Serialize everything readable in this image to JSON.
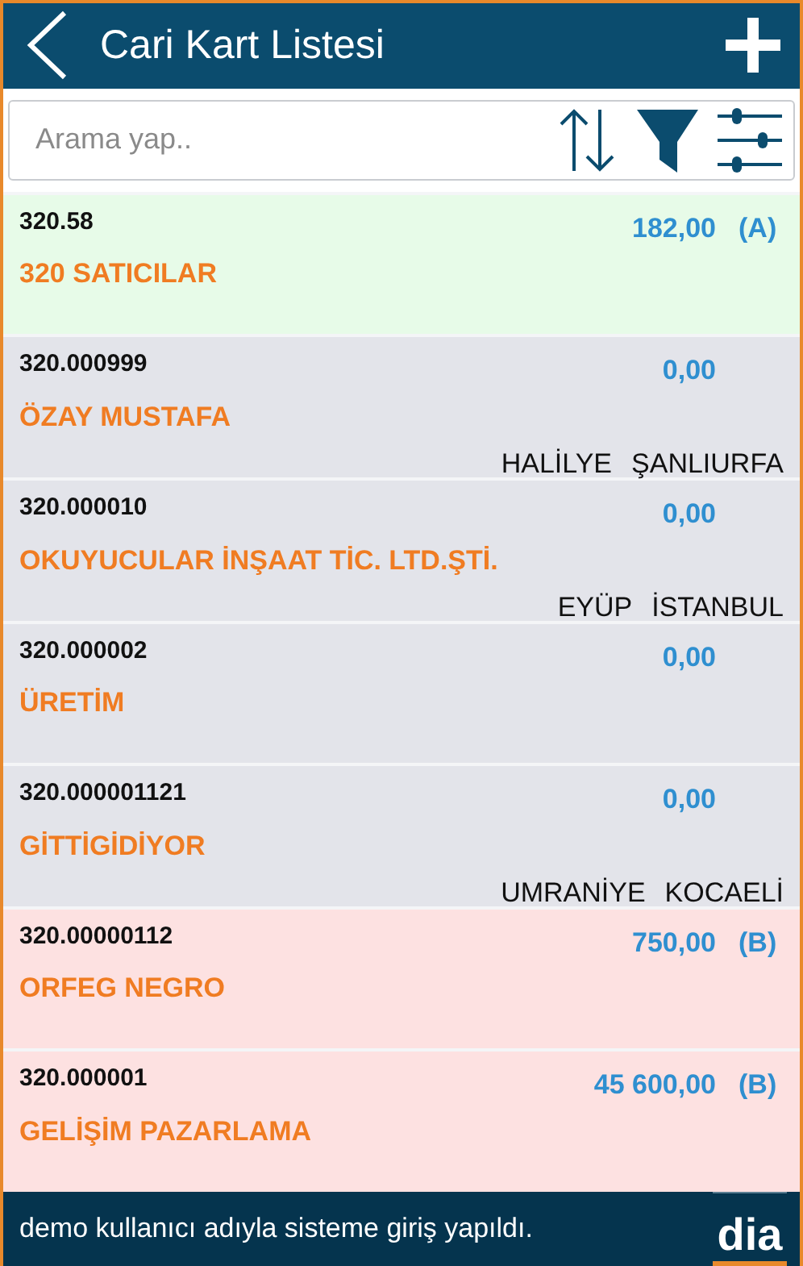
{
  "header": {
    "title": "Cari Kart Listesi"
  },
  "search": {
    "placeholder": "Arama yap.."
  },
  "accounts": [
    {
      "code": "320.58",
      "name": "320 SATICILAR",
      "balance": "182,00",
      "side": "(A)",
      "color": "#e7fbe8"
    },
    {
      "code": "320.000999",
      "name": "ÖZAY MUSTAFA",
      "balance": "0,00",
      "district": "HALİLYE",
      "city": "ŞANLIURFA",
      "color": "#e3e4ea"
    },
    {
      "code": "320.000010",
      "name": "OKUYUCULAR İNŞAAT TİC. LTD.ŞTİ.",
      "balance": "0,00",
      "district": "EYÜP",
      "city": "İSTANBUL",
      "color": "#e3e4ea"
    },
    {
      "code": "320.000002",
      "name": "ÜRETİM",
      "balance": "0,00",
      "color": "#e3e4ea"
    },
    {
      "code": "320.000001121",
      "name": "GİTTİGİDİYOR",
      "balance": "0,00",
      "district": "UMRANİYE",
      "city": "KOCAELİ",
      "color": "#e3e4ea"
    },
    {
      "code": "320.00000112",
      "name": "ORFEG NEGRO",
      "balance": "750,00",
      "side": "(B)",
      "color": "#fde1e1"
    },
    {
      "code": "320.000001",
      "name": "GELİŞİM PAZARLAMA",
      "balance": "45 600,00",
      "side": "(B)",
      "color": "#fde1e1"
    }
  ],
  "status_bar": {
    "message": "demo kullanıcı adıyla sisteme giriş yapıldı.",
    "logo": "dia"
  }
}
